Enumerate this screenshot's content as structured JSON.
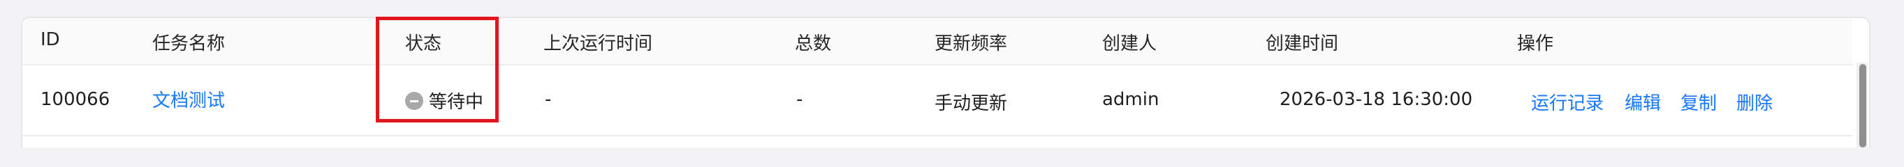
{
  "table": {
    "columns": [
      "ID",
      "任务名称",
      "状态",
      "上次运行时间",
      "总数",
      "更新频率",
      "创建人",
      "创建时间",
      "操作"
    ],
    "rows": [
      {
        "id": "100066",
        "task_name": "文档测试",
        "status": "等待中",
        "last_run_time": "-",
        "total": "-",
        "update_frequency": "手动更新",
        "creator": "admin",
        "created_time": "2026-03-18 16:30:00",
        "actions": [
          "运行记录",
          "编辑",
          "复制",
          "删除"
        ]
      }
    ]
  },
  "icons": {
    "status": "pending-minus-circle-icon"
  },
  "colors": {
    "link": "#1677ff",
    "highlight_border": "#e3161e",
    "status_icon": "#a8a8a8",
    "header_bg": "#fafafa"
  }
}
